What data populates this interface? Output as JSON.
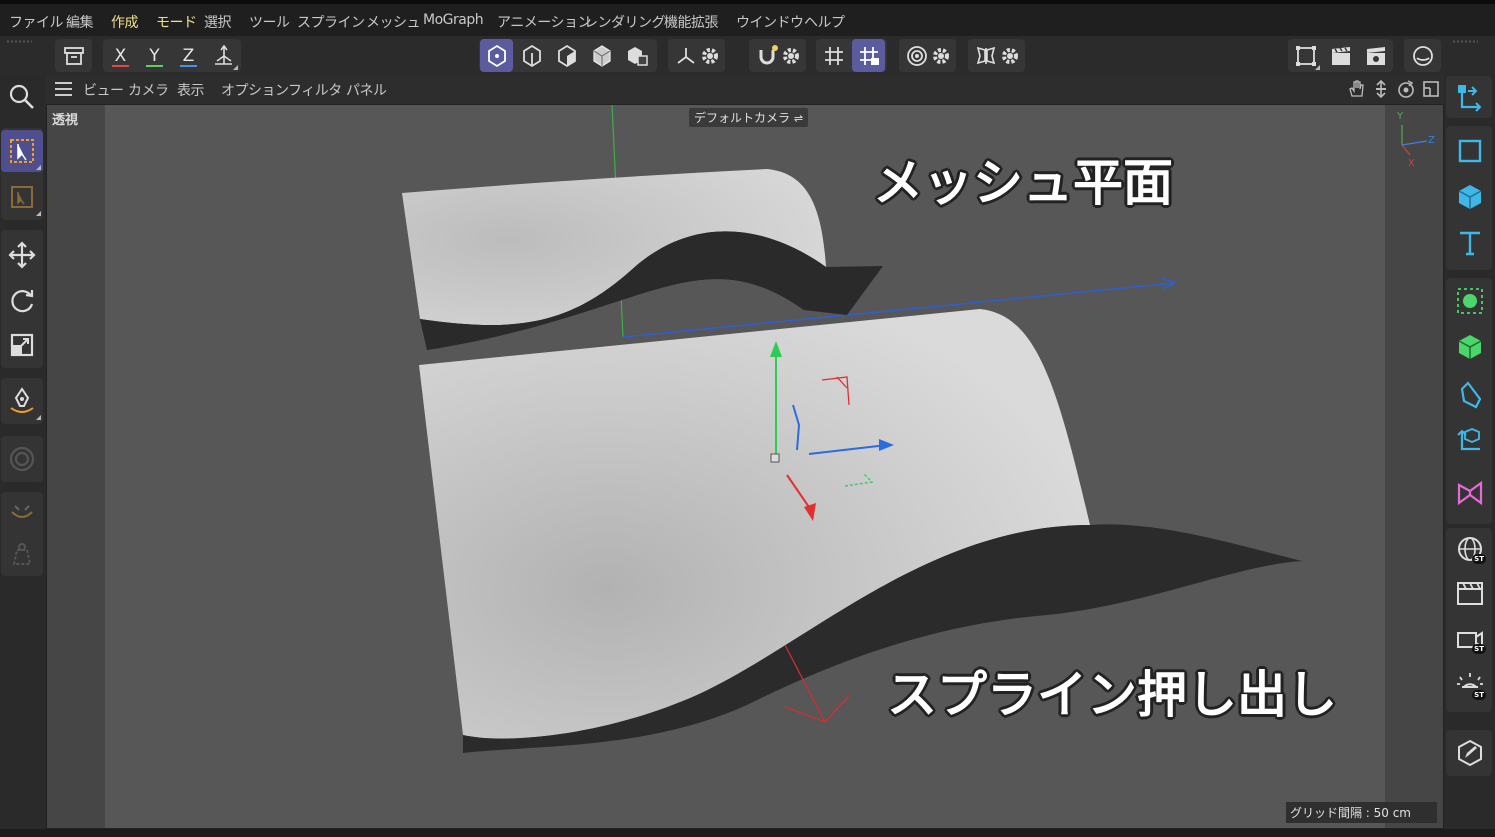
{
  "menu": {
    "items": [
      {
        "label": "ファイル",
        "active": false
      },
      {
        "label": "編集",
        "active": false
      },
      {
        "label": "作成",
        "active": true
      },
      {
        "label": "モード",
        "active": true
      },
      {
        "label": "選択",
        "active": false
      },
      {
        "label": "ツール",
        "active": false
      },
      {
        "label": "スプライン",
        "active": false
      },
      {
        "label": "メッシュ",
        "active": false
      },
      {
        "label": "MoGraph",
        "active": false
      },
      {
        "label": "アニメーション",
        "active": false
      },
      {
        "label": "レンダリング",
        "active": false
      },
      {
        "label": "機能拡張",
        "active": false
      },
      {
        "label": "ウインドウ",
        "active": false
      },
      {
        "label": "ヘルプ",
        "active": false
      }
    ]
  },
  "toolbar": {
    "axis_x": "X",
    "axis_y": "Y",
    "axis_z": "Z",
    "colors": {
      "x": "#e04848",
      "y": "#5ccf5c",
      "z": "#4a8ee8",
      "selected": "#5b5b9e"
    }
  },
  "viewport_menu": {
    "items": [
      "ビュー",
      "カメラ",
      "表示",
      "オプション",
      "フィルタ",
      "パネル"
    ]
  },
  "viewport": {
    "view_name": "透視",
    "camera_label": "デフォルトカメラ",
    "grid_spacing": "グリッド間隔 : 50 cm",
    "background": "#575757"
  },
  "overlay": {
    "title_top": "メッシュ平面",
    "title_bottom": "スプライン押し出し"
  },
  "orientation_gizmo": {
    "y": "Y",
    "z": "Z",
    "x": "X"
  }
}
